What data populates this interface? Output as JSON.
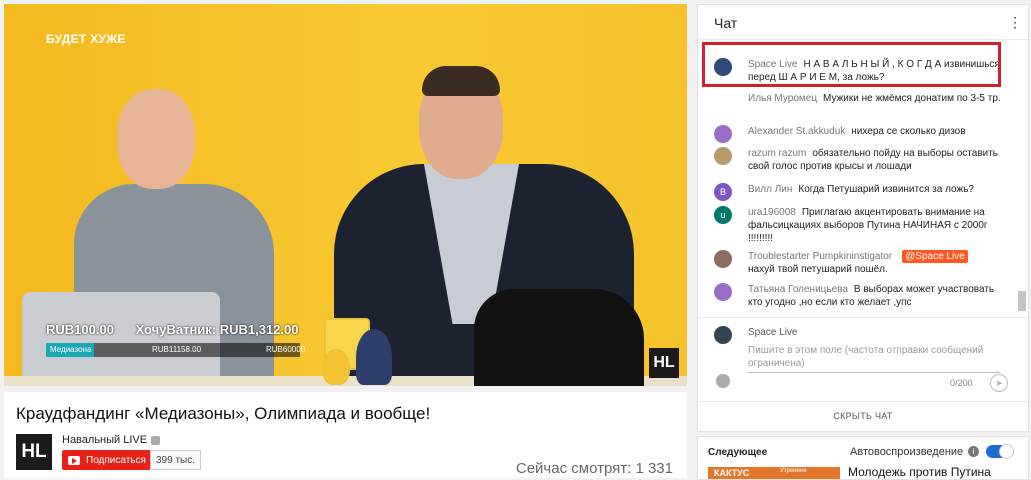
{
  "video": {
    "top_label": "БУДЕТ ХУЖЕ",
    "donation_amount": "RUB100.00",
    "donation_text": "ХочуВатник: RUB1,312.00",
    "progress_name": "Медиазона",
    "progress_current": "RUB11158.00",
    "progress_goal": "RUB60000",
    "progress_fraction": 0.19,
    "logo": "HL"
  },
  "info": {
    "title": "Краудфандинг «Медиазоны», Олимпиада и вообще!",
    "channel_name": "Навальный LIVE",
    "channel_logo": "HL",
    "subscribe_label": "Подписаться",
    "subscriber_count": "399 тыс.",
    "viewers": "Сейчас смотрят: 1 331"
  },
  "chat": {
    "title": "Чат",
    "messages": [
      {
        "author": "Space Live",
        "text": "Н А В А Л Ь Н Ы Й , К О Г Д А извинишься перед Ш А Р И Е М, за ложь?",
        "avatar_letter": "",
        "avatar_color": "#2e4a78"
      },
      {
        "author": "Илья Муромец",
        "text": "Мужики не жмёмся донатим по 3-5 тр.",
        "avatar_letter": "",
        "avatar_color": ""
      },
      {
        "author": "Alexander St.akkuduk",
        "text": "нихера се сколько дизов",
        "avatar_letter": "",
        "avatar_color": "#9b6dc9"
      },
      {
        "author": "razum razum",
        "text": "обязательно пойду на выборы оставить свой голос против крысы и лошади",
        "avatar_letter": "",
        "avatar_color": "#b59a6c"
      },
      {
        "author": "Вилл Лин",
        "text": "Когда Петушарий извинится за ложь?",
        "avatar_letter": "В",
        "avatar_color": "#7e57c2"
      },
      {
        "author": "ura196008",
        "text": "Приглагаю акцентировать внимание на фальсицкациях выборов Путина НАЧИНАЯ с 2000г !!!!!!!!!",
        "avatar_letter": "u",
        "avatar_color": "#00796b"
      },
      {
        "author": "Troublestarter Pumpkininstigator",
        "mention": "@Space Live",
        "text": "нахуй твой петушарий пошёл.",
        "avatar_letter": "",
        "avatar_color": "#8d6e63"
      },
      {
        "author": "Татьяна Голеницьева",
        "text": "В выборах может участвовать кто угодно ,но если кто желает ,упс",
        "avatar_letter": "",
        "avatar_color": "#9b6dc9"
      }
    ],
    "composer_user": "Space Live",
    "composer_placeholder": "Пишите в этом поле (частота отправки сообщений ограничена)",
    "counter": "0/200",
    "hide_label": "СКРЫТЬ ЧАТ"
  },
  "next": {
    "label": "Следующее",
    "autoplay_label": "Автовоспроизведение",
    "autoplay_on": true,
    "thumb_title": "КАКТУС",
    "thumb_sub": "Утреннее",
    "title": "Молодежь против Путина"
  }
}
